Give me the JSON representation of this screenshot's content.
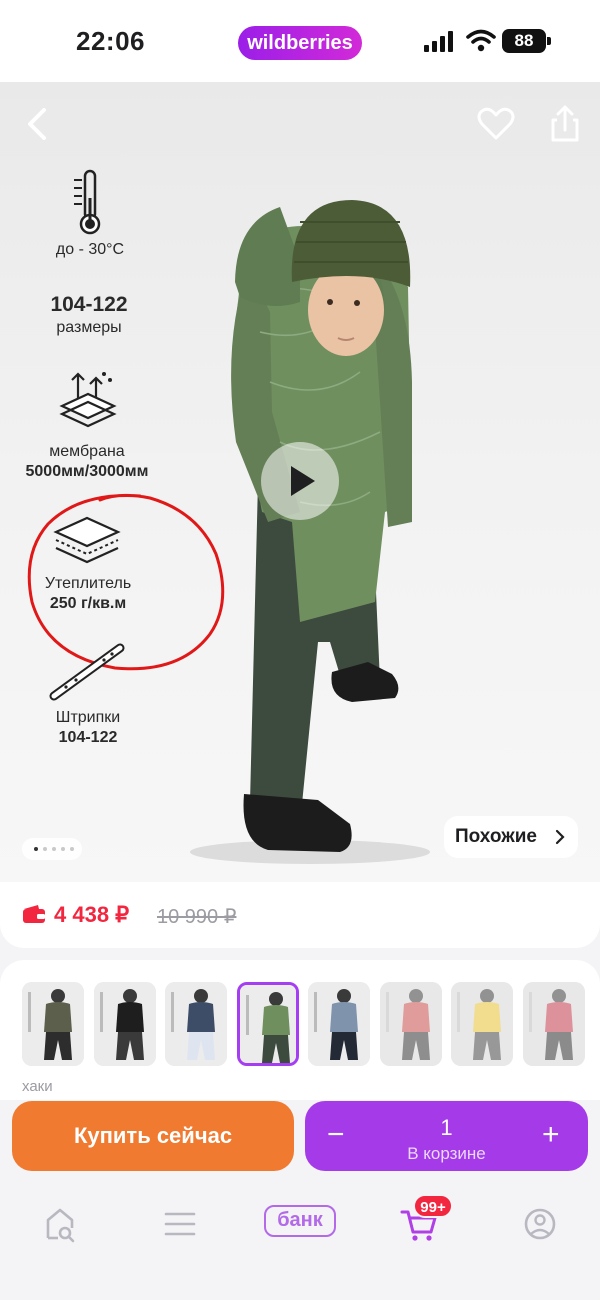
{
  "status_bar": {
    "time": "22:06",
    "brand": "wildberries",
    "battery": "88"
  },
  "product_gallery": {
    "features": [
      {
        "line1": "до - 30°C",
        "line2": ""
      },
      {
        "line1": "104-122",
        "line2": "размеры"
      },
      {
        "line1": "мембрана",
        "line2": "5000мм/3000мм"
      },
      {
        "line1": "Утеплитель",
        "line2": "250 г/кв.м"
      },
      {
        "line1": "Штрипки",
        "line2": "104-122"
      }
    ],
    "similar_label": "Похожие",
    "slide_count": 5,
    "active_slide": 0,
    "colors": {
      "jumpsuit": "#6f8f5f",
      "pants": "#3d4a3e",
      "annotation": "#e01818"
    }
  },
  "price": {
    "current": "4 438 ₽",
    "old": "10 990 ₽",
    "accent": "#f2263f"
  },
  "thumbnails": {
    "selected_index": 3,
    "items": [
      {
        "main": "#5b5f4c",
        "accent": "#2d2d2d",
        "muted": false
      },
      {
        "main": "#1e1e1e",
        "accent": "#3a3a3a",
        "muted": false
      },
      {
        "main": "#3d4d68",
        "accent": "#dfe5f0",
        "muted": false
      },
      {
        "main": "#6f8f5f",
        "accent": "#3d4a3e",
        "muted": false
      },
      {
        "main": "#7f93ad",
        "accent": "#232a36",
        "muted": false
      },
      {
        "main": "#c84a4a",
        "accent": "#333333",
        "muted": true
      },
      {
        "main": "#e8c232",
        "accent": "#444444",
        "muted": true
      },
      {
        "main": "#c23a4a",
        "accent": "#2d2d2d",
        "muted": true
      }
    ],
    "color_label": "хаки"
  },
  "actions": {
    "buy_now": "Купить сейчас",
    "cart_qty": "1",
    "cart_label": "В корзине",
    "minus": "−",
    "plus": "+"
  },
  "tabbar": {
    "bank": "банк",
    "cart_badge": "99+"
  }
}
